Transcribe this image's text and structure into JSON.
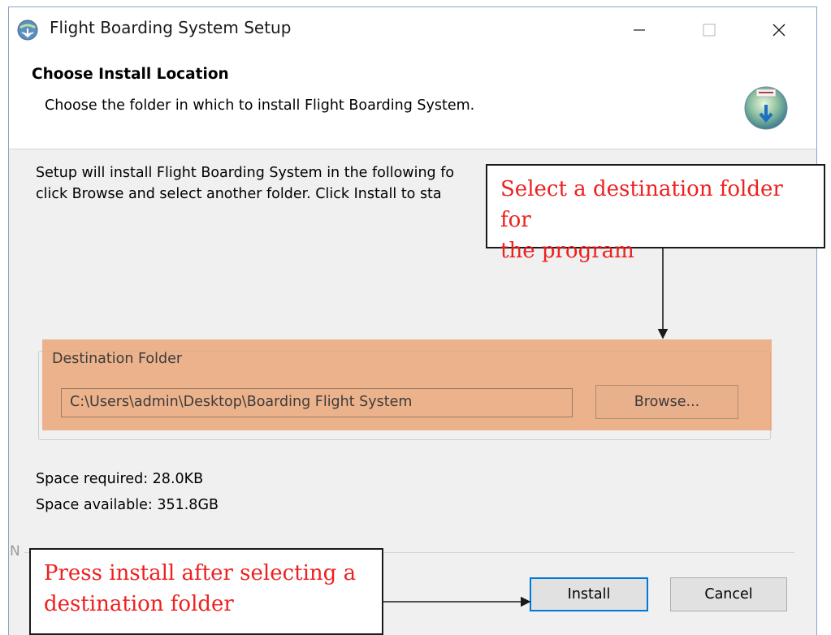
{
  "window": {
    "title": "Flight Boarding System Setup"
  },
  "header": {
    "title": "Choose Install Location",
    "subtitle": "Choose the folder in which to install Flight Boarding System."
  },
  "body": {
    "intro_line1": "Setup will install Flight Boarding System in the following fo",
    "intro_line2": "click Browse and select another folder. Click Install to sta"
  },
  "destination": {
    "group_label": "Destination Folder",
    "path_value": "C:\\Users\\admin\\Desktop\\Boarding Flight System",
    "browse_label": "Browse..."
  },
  "space": {
    "required": "Space required: 28.0KB",
    "available": "Space available: 351.8GB"
  },
  "footer": {
    "brand_fragment": "N",
    "install_label": "Install",
    "cancel_label": "Cancel"
  },
  "annotations": {
    "top_line1": "Select a destination folder for",
    "top_line2": "the program",
    "bottom_line1": "Press install after selecting a",
    "bottom_line2": "destination folder"
  },
  "colors": {
    "annotation_text": "#ee2020",
    "highlight": "#eba06e",
    "focus_border": "#0078d7"
  },
  "icons": {
    "app": "installer-globe-icon",
    "header": "install-disc-icon",
    "minimize": "minimize-icon",
    "maximize": "maximize-icon",
    "close": "close-icon"
  }
}
